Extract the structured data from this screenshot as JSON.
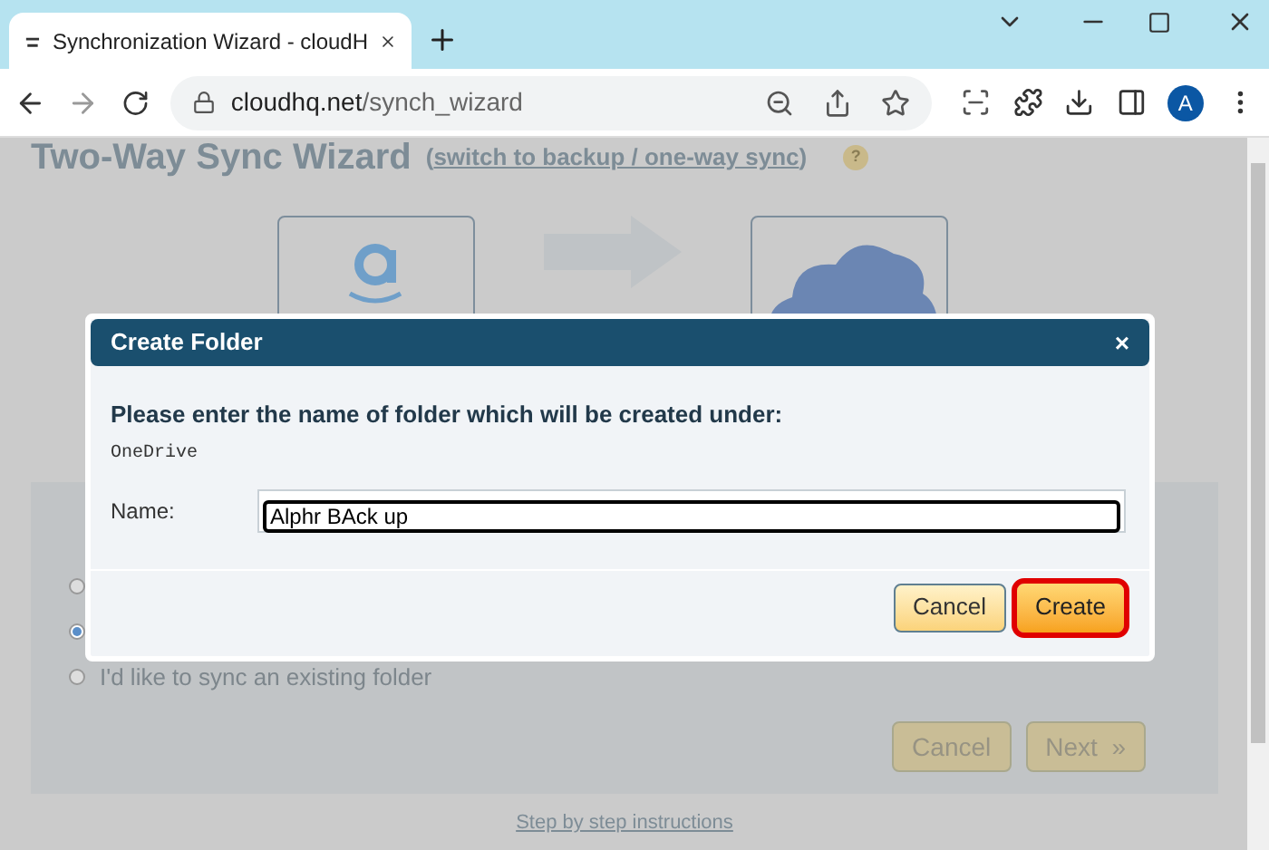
{
  "browser": {
    "tab_title": "Synchronization Wizard - cloudH",
    "url_host": "cloudhq.net",
    "url_path": "/synch_wizard",
    "avatar": "A"
  },
  "page": {
    "title": "Two-Way Sync Wizard",
    "switch_link_open": "(",
    "switch_link": "switch to backup / one-way sync",
    "switch_link_close": ")",
    "help": "?",
    "radios": [
      {
        "selected": false
      },
      {
        "selected": true
      },
      {
        "label": "I'd like to sync an existing folder",
        "selected": false
      }
    ],
    "buttons": [
      "Cancel",
      "Next  »"
    ],
    "footer_link": "Step by step instructions"
  },
  "dialog": {
    "title": "Create Folder",
    "close": "×",
    "prompt": "Please enter the name of folder which will be created under:",
    "parent_folder": "OneDrive",
    "name_label": "Name:",
    "name_value": "Alphr BAck up",
    "buttons": [
      {
        "label": "Cancel",
        "kind": "secondary"
      },
      {
        "label": "Create",
        "kind": "primary"
      }
    ]
  }
}
